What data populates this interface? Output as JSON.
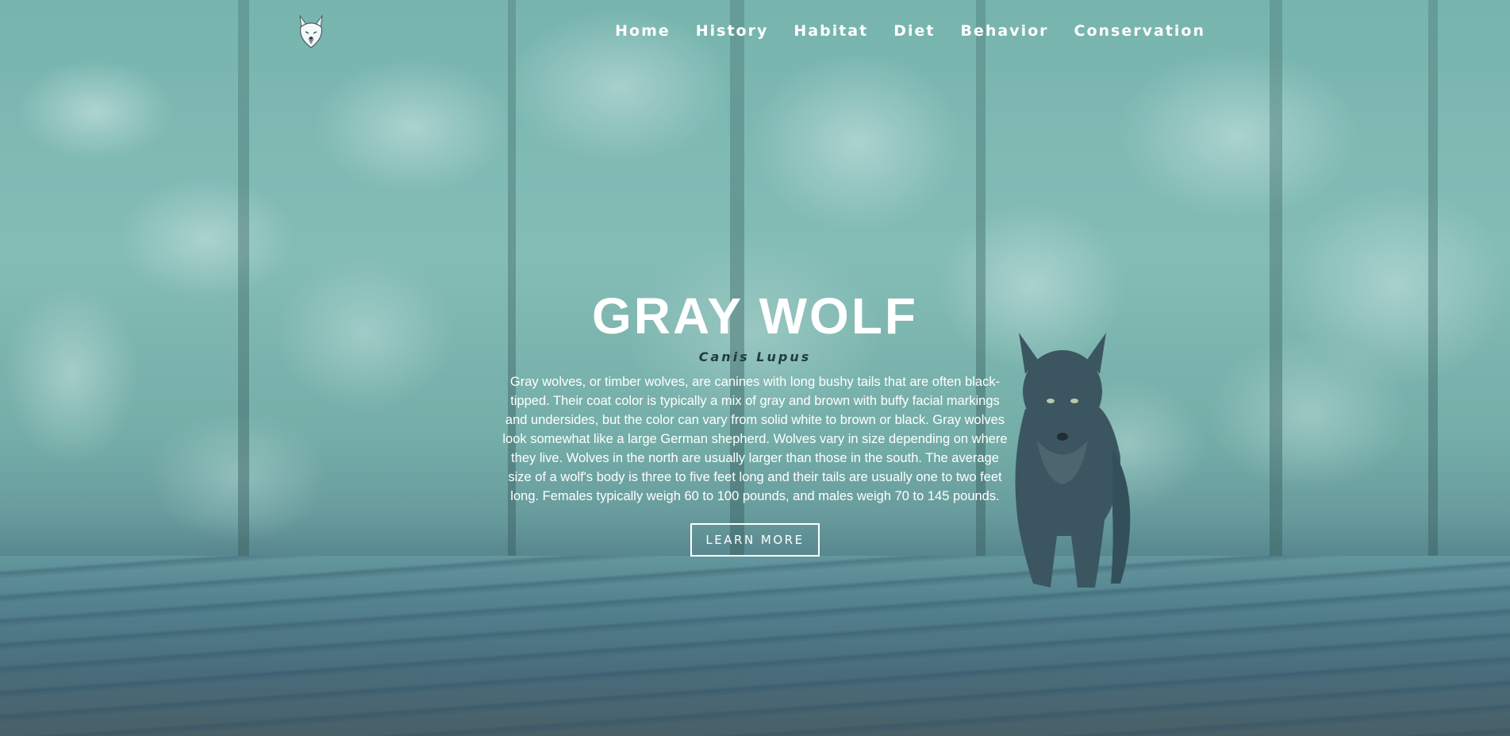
{
  "nav": {
    "logo_icon": "wolf-head-logo-icon",
    "items": [
      {
        "label": "Home"
      },
      {
        "label": "History"
      },
      {
        "label": "Habitat"
      },
      {
        "label": "Diet"
      },
      {
        "label": "Behavior"
      },
      {
        "label": "Conservation"
      }
    ]
  },
  "hero": {
    "title": "GRAY WOLF",
    "subtitle": "Canis Lupus",
    "description": "Gray wolves, or timber wolves, are canines with long bushy tails that are often black-tipped. Their coat color is typically a mix of gray and brown with buffy facial markings and undersides, but the color can vary from solid white to brown or black. Gray wolves look somewhat like a large German shepherd. Wolves vary in size depending on where they live. Wolves in the north are usually larger than those in the south. The average size of a wolf's body is three to five feet long and their tails are usually one to two feet long. Females typically weigh 60 to 100 pounds, and males weigh 70 to 145 pounds.",
    "button_label": "LEARN MORE",
    "background_image": "snowy-forest-with-wolf"
  },
  "colors": {
    "text": "#ffffff",
    "subtitle": "#1f3b44",
    "overlay": "#5fa8a4"
  }
}
